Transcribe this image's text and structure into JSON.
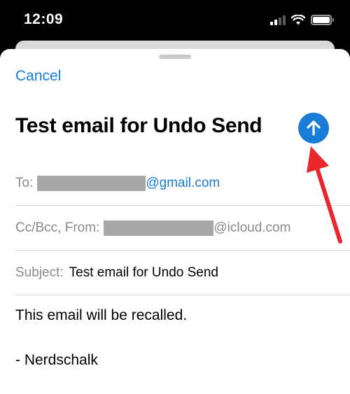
{
  "status_bar": {
    "time": "12:09"
  },
  "compose": {
    "cancel_label": "Cancel",
    "title": "Test email for Undo Send",
    "to_label": "To:",
    "to_domain": "@gmail.com",
    "ccbcc_label": "Cc/Bcc, From:",
    "from_domain": "@icloud.com",
    "subject_label": "Subject:",
    "subject_value": "Test email for Undo Send",
    "body_line1": "This email will be recalled.",
    "body_line2": "- Nerdschalk"
  },
  "icons": {
    "send": "arrow-up-icon",
    "signal": "cellular-signal-icon",
    "wifi": "wifi-icon",
    "battery": "battery-icon",
    "annotation": "red-pointer-arrow"
  },
  "colors": {
    "accent": "#1a7cd9",
    "annotation": "#e8262b",
    "redacted": "#a8a8a8"
  }
}
